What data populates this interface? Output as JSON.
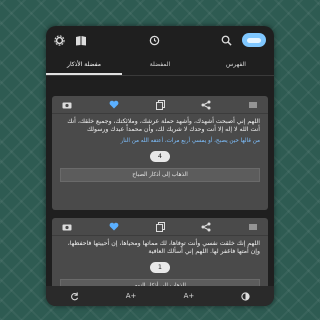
{
  "header": {
    "icons": [
      "gear-icon",
      "book-icon",
      "clock-icon",
      "search-icon"
    ],
    "logo": "app-logo"
  },
  "tabs": [
    {
      "label": "الفهرس"
    },
    {
      "label": "المفضلة"
    },
    {
      "label": "مفضلة الأذكار"
    }
  ],
  "cards": [
    {
      "text": "اللهم إني أصبحت أشهدك، وأشهد حملة عرشك، وملائكتك، وجميع خلقك، أنك أنت الله لا إله إلا أنت وحدك لا شريك لك، وأن محمداً عبدك ورسولك",
      "note": "من قالها حين يصبح، أو يمسي أربع مرات، أعتقه الله من النار",
      "counter": "4",
      "action": "الذهاب إلى أذكار الصباح"
    },
    {
      "text": "اللهم إنك خلقت نفسي وأنت توفاها، لك مماتها ومحياها، إن أحييتها فاحفظها، وإن أمتها فاغفر لها. اللهم إني أسألك العافية",
      "counter": "1",
      "action": "الذهاب إلى أذكار النوم"
    }
  ],
  "bottom": {
    "font_increase": "A+",
    "font_increase_2": "A+"
  },
  "colors": {
    "accent": "#5bb0ff",
    "background": "#2e5b52",
    "card": "#4a4a4a"
  }
}
